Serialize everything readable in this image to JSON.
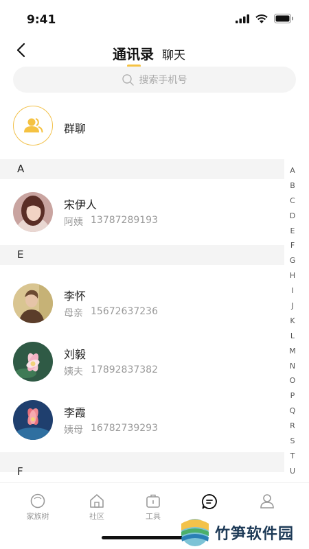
{
  "status_bar": {
    "time": "9:41"
  },
  "header": {
    "tabs": [
      {
        "label": "通讯录",
        "active": true
      },
      {
        "label": "聊天",
        "active": false
      }
    ]
  },
  "search": {
    "placeholder": "搜索手机号"
  },
  "group_chat": {
    "label": "群聊"
  },
  "sections": [
    {
      "letter": "A",
      "contacts": [
        {
          "name": "宋伊人",
          "relation": "阿姨",
          "phone": "13787289193"
        }
      ]
    },
    {
      "letter": "E",
      "contacts": [
        {
          "name": "李怀",
          "relation": "母亲",
          "phone": "15672637236"
        },
        {
          "name": "刘毅",
          "relation": "姨夫",
          "phone": "17892837382"
        },
        {
          "name": "李霞",
          "relation": "姨母",
          "phone": "16782739293"
        }
      ]
    },
    {
      "letter": "F",
      "contacts": []
    }
  ],
  "index_letters": [
    "A",
    "B",
    "C",
    "D",
    "E",
    "F",
    "G",
    "H",
    "I",
    "J",
    "K",
    "L",
    "M",
    "N",
    "O",
    "P",
    "Q",
    "R",
    "S",
    "T",
    "U"
  ],
  "tabbar": [
    {
      "label": "家族树",
      "icon": "family-tree-icon"
    },
    {
      "label": "社区",
      "icon": "community-icon"
    },
    {
      "label": "工具",
      "icon": "toolbox-icon"
    },
    {
      "label": "",
      "icon": "message-icon",
      "active": true
    },
    {
      "label": "",
      "icon": "profile-icon"
    }
  ],
  "watermark": {
    "text": "竹笋软件园"
  },
  "colors": {
    "accent": "#f5c242",
    "section_bg": "#f4f4f4",
    "subtext": "#9a9a9a"
  }
}
